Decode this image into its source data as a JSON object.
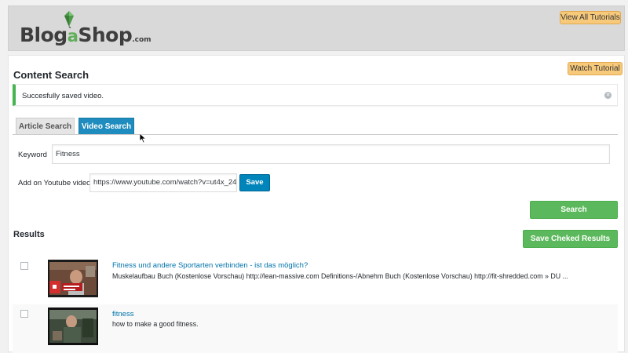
{
  "header": {
    "logo": {
      "part1": "Blog",
      "part2": "a",
      "part3": "Shop",
      "suffix": ".com"
    },
    "view_all_tutorials": "View All Tutorials"
  },
  "page": {
    "watch_tutorial": "Watch Tutorial",
    "title": "Content Search",
    "notice": {
      "text": "Succesfully saved video.",
      "close_icon": "close-icon"
    }
  },
  "tabs": [
    {
      "label": "Article Search",
      "active": false
    },
    {
      "label": "Video Search",
      "active": true
    }
  ],
  "form": {
    "keyword_label": "Keyword",
    "keyword_value": "Fitness",
    "youtube_label": "Add on Youtube video",
    "youtube_value": "https://www.youtube.com/watch?v=ut4x_24",
    "save_label": "Save",
    "search_label": "Search"
  },
  "results": {
    "title": "Results",
    "save_checked_label": "Save Cheked Results",
    "items": [
      {
        "title": "Fitness und andere Sportarten verbinden - ist das möglich?",
        "description": "Muskelaufbau Buch (Kostenlose Vorschau) http://lean-massive.com Definitions-/Abnehm Buch (Kostenlose Vorschau) http://fit-shredded.com » DU ...",
        "checked": false
      },
      {
        "title": "fitness",
        "description": "how to make a good fitness.",
        "checked": false
      }
    ]
  },
  "colors": {
    "accent_blue": "#0085ba",
    "tab_active": "#1e8cbe",
    "success_green": "#5cb85c",
    "notice_green": "#46b450",
    "orange_button": "#f7c97b",
    "link": "#0073aa"
  }
}
